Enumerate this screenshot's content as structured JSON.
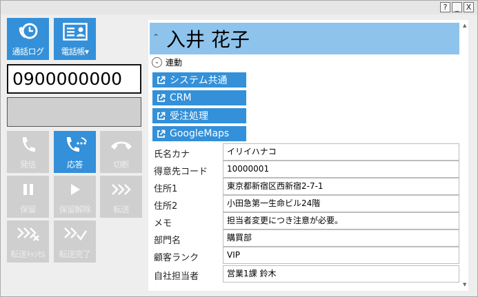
{
  "window": {
    "buttons": {
      "help": "?",
      "minimize": "_",
      "close": "X"
    }
  },
  "toolbar": {
    "call_log": "通話ログ",
    "phonebook": "電話帳▾"
  },
  "dialer": {
    "number": "0900000000",
    "status": ""
  },
  "call_controls": [
    {
      "id": "call",
      "label": "発信",
      "state": "disabled",
      "icon": "phone-icon"
    },
    {
      "id": "answer",
      "label": "応答",
      "state": "active",
      "icon": "phone-ringing-icon"
    },
    {
      "id": "hangup",
      "label": "切断",
      "state": "disabled",
      "icon": "hangup-icon"
    },
    {
      "id": "hold",
      "label": "保留",
      "state": "disabled",
      "icon": "pause-icon"
    },
    {
      "id": "unhold",
      "label": "保留解除",
      "state": "disabled",
      "icon": "play-icon"
    },
    {
      "id": "transfer",
      "label": "転送",
      "state": "disabled",
      "icon": "transfer-icon"
    },
    {
      "id": "transfer_cancel",
      "label": "転送ｷｬﾝｾﾙ",
      "state": "disabled",
      "icon": "transfer-cancel-icon"
    },
    {
      "id": "transfer_complete",
      "label": "転送完了",
      "state": "disabled",
      "icon": "transfer-complete-icon"
    }
  ],
  "contact": {
    "name": "入井 花子",
    "link_section_label": "連動",
    "links": [
      "システム共通",
      "CRM",
      "受注処理",
      "GoogleMaps"
    ],
    "fields": [
      {
        "label": "氏名カナ",
        "value": "イリイハナコ"
      },
      {
        "label": "得意先コード",
        "value": "10000001"
      },
      {
        "label": "住所1",
        "value": "東京都新宿区西新宿2-7-1"
      },
      {
        "label": "住所2",
        "value": "小田急第一生命ビル24階"
      },
      {
        "label": "メモ",
        "value": "担当者変更につき注意が必要。"
      },
      {
        "label": "部門名",
        "value": "購買部"
      },
      {
        "label": "顧客ランク",
        "value": "VIP"
      },
      {
        "label": "自社担当者",
        "value": "営業1課 鈴木"
      }
    ]
  },
  "colors": {
    "accent": "#3390d9",
    "header": "#8ec4ec",
    "disabled": "#cfcfcf",
    "background": "#eeeeee"
  }
}
